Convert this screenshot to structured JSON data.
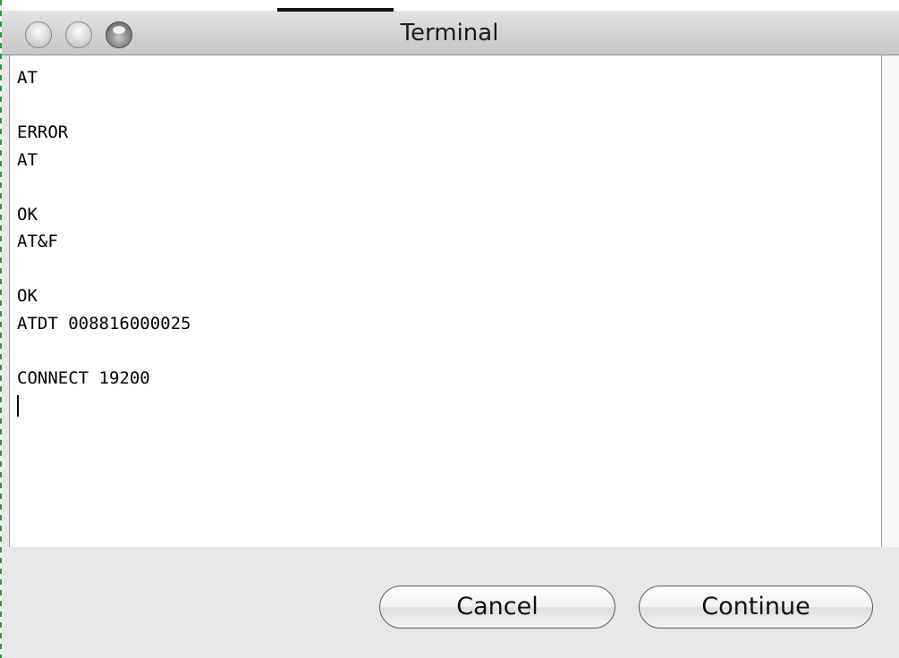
{
  "window": {
    "title": "Terminal"
  },
  "terminal": {
    "lines": [
      "AT",
      "",
      "ERROR",
      "AT",
      "",
      "OK",
      "AT&F",
      "",
      "OK",
      "ATDT 008816000025",
      "",
      "CONNECT 19200"
    ]
  },
  "buttons": {
    "cancel": "Cancel",
    "continue": "Continue"
  },
  "icons": {
    "close": "close-icon",
    "minimize": "minimize-icon",
    "zoom": "zoom-icon"
  },
  "colors": {
    "left_edge": "#2a9a3a",
    "background": "#e8e8e8"
  }
}
